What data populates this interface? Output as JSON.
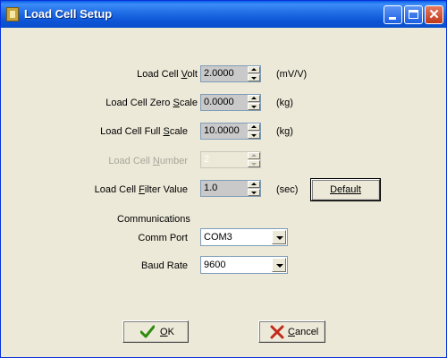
{
  "window": {
    "title": "Load Cell Setup"
  },
  "settings": {
    "volt": {
      "label": "Load Cell Volt",
      "value": "2.0000",
      "unit": "(mV/V)"
    },
    "zero": {
      "label": "Load Cell Zero Scale",
      "value": "0.0000",
      "unit": "(kg)"
    },
    "full": {
      "label": "Load Cell Full Scale",
      "value": "10.0000",
      "unit": "(kg)"
    },
    "number": {
      "label": "Load Cell Number",
      "value": "2",
      "disabled": true
    },
    "filter": {
      "label": "Load Cell Filter Value",
      "value": "1.0",
      "unit": "(sec)"
    },
    "default_label": "Default"
  },
  "communications": {
    "heading": "Communications",
    "comm_port": {
      "label": "Comm Port",
      "value": "COM3"
    },
    "baud_rate": {
      "label": "Baud Rate",
      "value": "9600"
    }
  },
  "actions": {
    "ok_label": "OK",
    "cancel_label": "Cancel"
  },
  "icons": {
    "ok": "check-icon",
    "cancel": "x-icon",
    "app": "load-cell-app-icon"
  },
  "colors": {
    "titlebar": "#0A5FE8",
    "dialog_bg": "#ECE9D8",
    "ok_check": "#2E8B0E",
    "cancel_x": "#C1291A"
  }
}
